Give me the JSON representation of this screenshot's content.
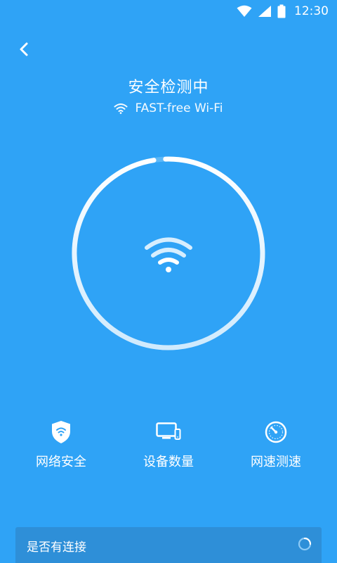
{
  "status_bar": {
    "time": "12:30",
    "icons": [
      "wifi-signal-icon",
      "cell-signal-icon",
      "battery-icon"
    ]
  },
  "header": {
    "back_icon": "chevron-left-icon",
    "title": "安全检测中",
    "ssid": "FAST-free Wi-Fi",
    "ssid_icon": "wifi-icon"
  },
  "progress": {
    "value": 0.98,
    "center_icon": "wifi-icon"
  },
  "features": [
    {
      "label": "网络安全",
      "icon": "shield-wifi-icon"
    },
    {
      "label": "设备数量",
      "icon": "devices-icon"
    },
    {
      "label": "网速测速",
      "icon": "speedometer-icon"
    }
  ],
  "check_item": {
    "label": "是否有连接",
    "icon": "loading-spinner-icon"
  },
  "colors": {
    "background": "#2fa3f6",
    "card": "#2e8fd8",
    "ring_track": "#5cb8f8",
    "ring_fill": "#ffffff"
  }
}
